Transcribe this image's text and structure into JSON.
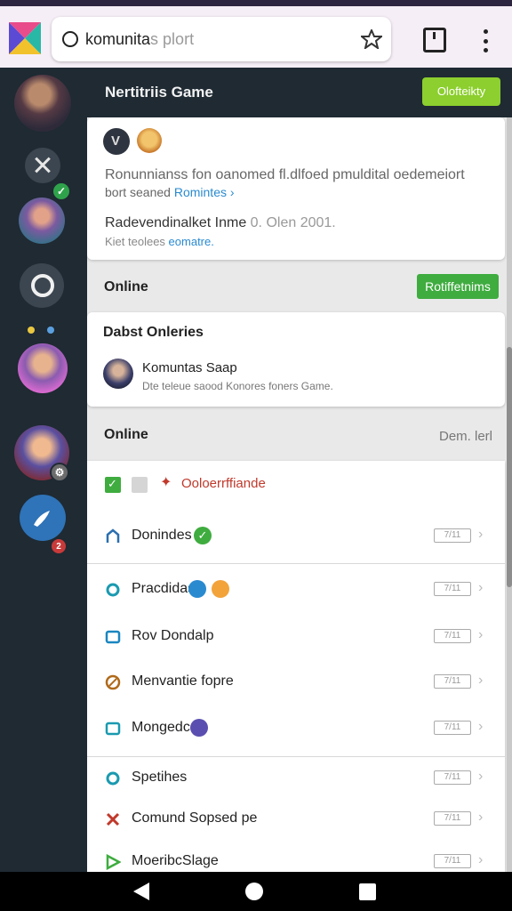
{
  "browser": {
    "url_typed": "komunita",
    "url_suggest": "s plort"
  },
  "channel": {
    "title": "Nertitriis Game",
    "header_button": "Olofteikty"
  },
  "announcement": {
    "line1": "Ronunnianss fon oanomed fl.dlfoed pmuldital oedemeiort",
    "line2_text": "bort seaned ",
    "line2_link": "Romintes ›",
    "line3_main": "Radevendinalket Inme ",
    "line3_dim": "0. Olen 2001.",
    "line4_text": "Kiet teolees ",
    "line4_link": "eomatre."
  },
  "online_section": {
    "label": "Online",
    "button": "Rotiffetnims"
  },
  "latest": {
    "title": "Dabst Onleries",
    "name": "Komuntas Saap",
    "subtitle": "Dte teleue saood  Konores foners Game."
  },
  "online_list": {
    "label": "Online",
    "right_label": "Dem. lerl",
    "header_label": "Ooloerrffiande",
    "pill_text": "7/11",
    "rows": [
      {
        "label": "Donindes"
      },
      {
        "label": "Pracdidas"
      },
      {
        "label": "Rov Dondalp"
      },
      {
        "label": "Menvantie fopre"
      },
      {
        "label": "Mongedc"
      },
      {
        "label": "Spetihes"
      },
      {
        "label": "Comund Sopsed pe"
      },
      {
        "label": "MoeribcSlage"
      }
    ]
  },
  "colors": {
    "accent_green": "#3fac3f",
    "header_button": "#8ccf2e",
    "link_blue": "#2a8ad0",
    "alert_red": "#c0392b"
  }
}
